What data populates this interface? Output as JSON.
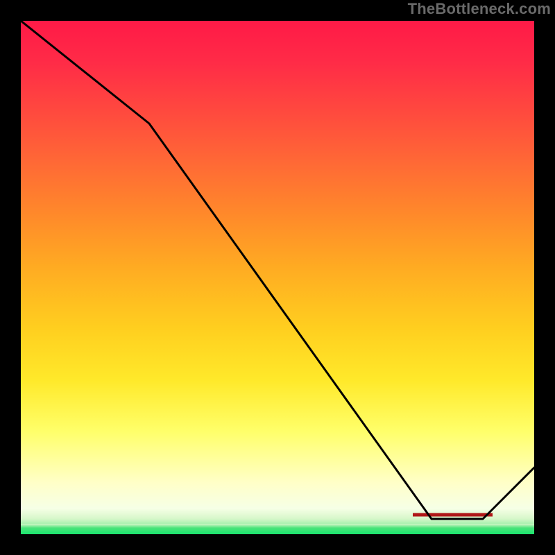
{
  "watermark": "TheBottleneck.com",
  "chart_data": {
    "type": "line",
    "title": "",
    "xlabel": "",
    "ylabel": "",
    "xlim": [
      0,
      100
    ],
    "ylim": [
      0,
      100
    ],
    "grid": false,
    "series": [
      {
        "name": "bottleneck-curve",
        "x": [
          0,
          25,
          80,
          90,
          100
        ],
        "values": [
          100,
          80,
          3,
          3,
          13
        ]
      }
    ],
    "annotations": [
      {
        "name": "red-strip-label",
        "text": "",
        "x": 85,
        "y": 4
      }
    ],
    "colors": {
      "curve": "#000000",
      "annotation_text": "#c02020",
      "gradient_top": "#ff1a47",
      "gradient_mid": "#ffe92a",
      "gradient_bottom": "#19e56e"
    }
  },
  "red_label": {
    "text": ""
  }
}
